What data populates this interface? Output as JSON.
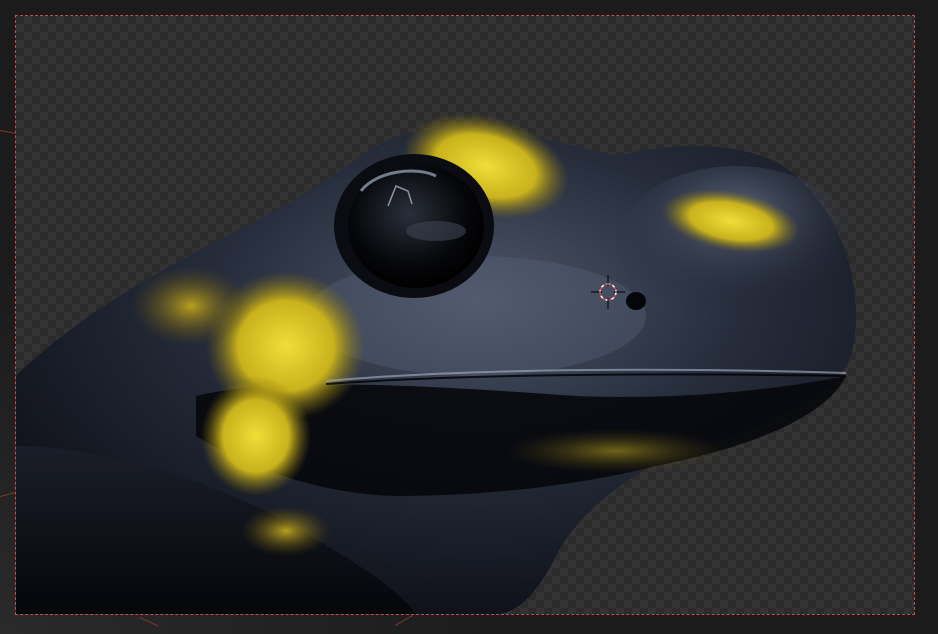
{
  "viewport": {
    "mode": "camera-view",
    "render_subject": "fire-salamander-head",
    "background": "transparent-checkerboard"
  },
  "colors": {
    "camera_border": "#c05050",
    "skin_dark": "#1b2030",
    "skin_highlight": "#6a7388",
    "spot_yellow": "#e8d020",
    "checker_light": "#333333",
    "checker_dark": "#2b2b2b"
  },
  "icons": {
    "cursor": "3d-cursor-icon"
  }
}
